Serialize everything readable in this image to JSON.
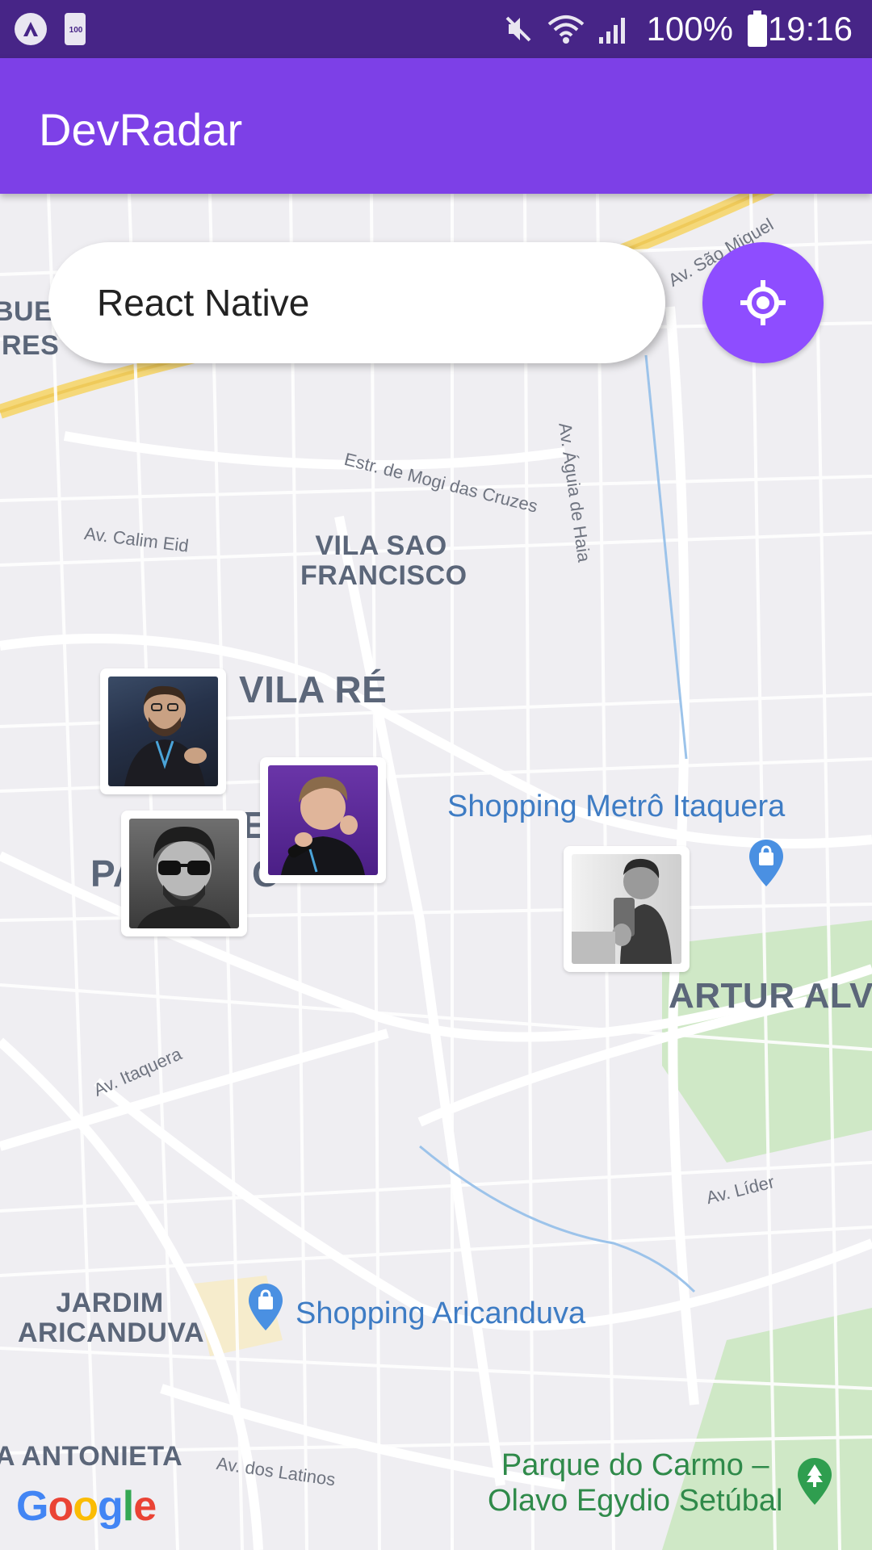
{
  "status_bar": {
    "battery_small": "100",
    "battery_text": "100%",
    "time": "19:16"
  },
  "app_bar": {
    "title": "DevRadar"
  },
  "search": {
    "value": "React Native"
  },
  "locate_button": {
    "icon": "my-location-icon"
  },
  "map": {
    "neighborhoods": {
      "vila_sao_francisco": "VILA SAO\nFRANCISCO",
      "vila_re": "VILA RÉ",
      "artur_alv": "ARTUR ALV",
      "jardim_aricanduva": "JARDIM\nARICANDUVA",
      "antonieta": "A ANTONIETA",
      "bue": "BUE",
      "ires": "IRES",
      "pa": "PA",
      "e_fragment": "E",
      "c_fragment": "C"
    },
    "streets": {
      "sao_miguel": "Av. São Miguel",
      "aguia_de_haia": "Av. Águia de Haia",
      "mogi_das_cruzes": "Estr. de Mogi das Cruzes",
      "calim_eid": "Av. Calim Eid",
      "itaquera": "Av. Itaquera",
      "lider": "Av. Líder",
      "latinos": "Av. dos Latinos"
    },
    "pois": {
      "shopping_metro": "Shopping Metrô Itaquera",
      "shopping_aricanduva": "Shopping Aricanduva",
      "parque_do_carmo": "Parque do Carmo –\nOlavo Egydio Setúbal"
    },
    "google": [
      "G",
      "o",
      "o",
      "g",
      "l",
      "e"
    ]
  },
  "colors": {
    "status_bar": "#472587",
    "app_bar": "#7d40e7",
    "locate_button": "#8e4dff",
    "map_background": "#efeef2"
  }
}
